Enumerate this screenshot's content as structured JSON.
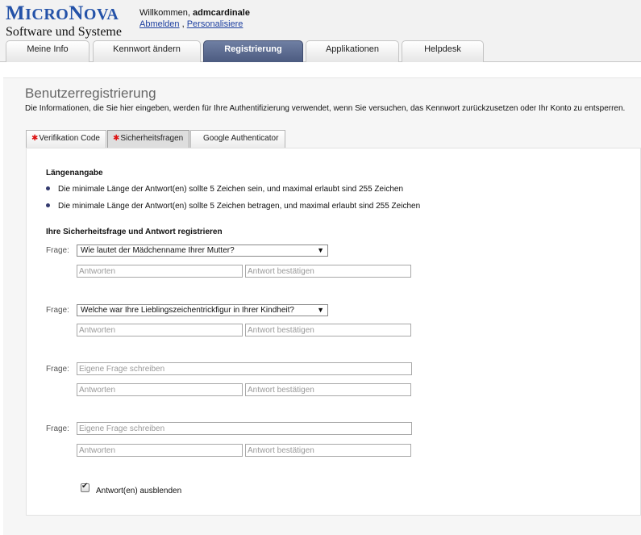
{
  "header": {
    "logo_main_first": "M",
    "logo_main_rest_a": "ICRO",
    "logo_main_mid": "N",
    "logo_main_rest_b": "OVA",
    "logo_sub": "Software und Systeme",
    "welcome_prefix": "Willkommen, ",
    "username": "admcardinale",
    "logout_link": "Abmelden",
    "link_separator": " , ",
    "personalize_link": "Personalisiere"
  },
  "top_tabs": [
    {
      "label": "Meine Info",
      "active": false
    },
    {
      "label": "Kennwort ändern",
      "active": false
    },
    {
      "label": "Registrierung",
      "active": true
    },
    {
      "label": "Applikationen",
      "active": false
    },
    {
      "label": "Helpdesk",
      "active": false
    }
  ],
  "page": {
    "title": "Benutzerregistrierung",
    "description": "Die Informationen, die Sie hier eingeben, werden für Ihre Authentifizierung verwendet, wenn Sie versuchen, das Kennwort zurückzusetzen oder Ihr Konto zu entsperren."
  },
  "sub_tabs": [
    {
      "label": "Verifikation Code",
      "required": true,
      "active": false
    },
    {
      "label": "Sicherheitsfragen",
      "required": true,
      "active": true
    },
    {
      "label": "Google Authenticator",
      "required": false,
      "active": false
    }
  ],
  "length_section": {
    "heading": "Längenangabe",
    "rules": [
      "Die minimale Länge der Antwort(en) sollte 5 Zeichen sein, und maximal erlaubt sind 255 Zeichen",
      "Die minimale Länge der Antwort(en) sollte 5 Zeichen betragen, und maximal erlaubt sind 255 Zeichen"
    ]
  },
  "questions_section": {
    "heading": "Ihre Sicherheitsfrage und Antwort registrieren",
    "question_label": "Frage:",
    "answer_placeholder": "Antworten",
    "confirm_placeholder": "Antwort bestätigen",
    "custom_question_placeholder": "Eigene Frage schreiben",
    "questions": [
      {
        "type": "select",
        "selected": "Wie lautet der Mädchenname Ihrer Mutter?"
      },
      {
        "type": "select",
        "selected": "Welche war Ihre Lieblingszeichentrickfigur in Ihrer Kindheit?"
      },
      {
        "type": "custom"
      },
      {
        "type": "custom"
      }
    ]
  },
  "hide_answers": {
    "label": "Antwort(en) ausblenden",
    "checked": true
  },
  "icons": {
    "dropdown_arrow": "triangle-down-icon",
    "required_marker": "asterisk-icon",
    "bullet": "dot-icon",
    "checkbox_check": "checkmark-icon"
  },
  "colors": {
    "brand_blue": "#2452a8",
    "active_tab": "#55648a",
    "required_red": "#d11111",
    "link_blue": "#1c3fa0"
  }
}
